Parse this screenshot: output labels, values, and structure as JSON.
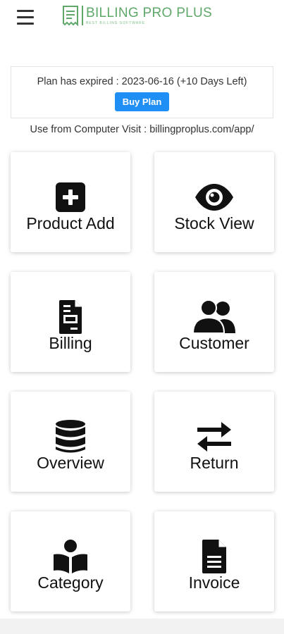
{
  "app": {
    "logo_title": "BILLING PRO PLUS",
    "logo_subtitle": "BEST BILLING SOFTWARE",
    "brand_color": "#5fa86a"
  },
  "plan": {
    "expired_text": "Plan has expired : 2023-06-16 (+10 Days Left)",
    "buy_label": "Buy Plan",
    "button_color": "#1f8ff5"
  },
  "visit_text": "Use from Computer Visit : billingproplus.com/app/",
  "tiles": [
    {
      "label": "Product Add",
      "icon": "plus-square-icon"
    },
    {
      "label": "Stock View",
      "icon": "eye-icon"
    },
    {
      "label": "Billing",
      "icon": "receipt-icon"
    },
    {
      "label": "Customer",
      "icon": "users-icon"
    },
    {
      "label": "Overview",
      "icon": "database-icon"
    },
    {
      "label": "Return",
      "icon": "exchange-arrows-icon"
    },
    {
      "label": "Category",
      "icon": "reader-book-icon"
    },
    {
      "label": "Invoice",
      "icon": "document-icon"
    }
  ]
}
